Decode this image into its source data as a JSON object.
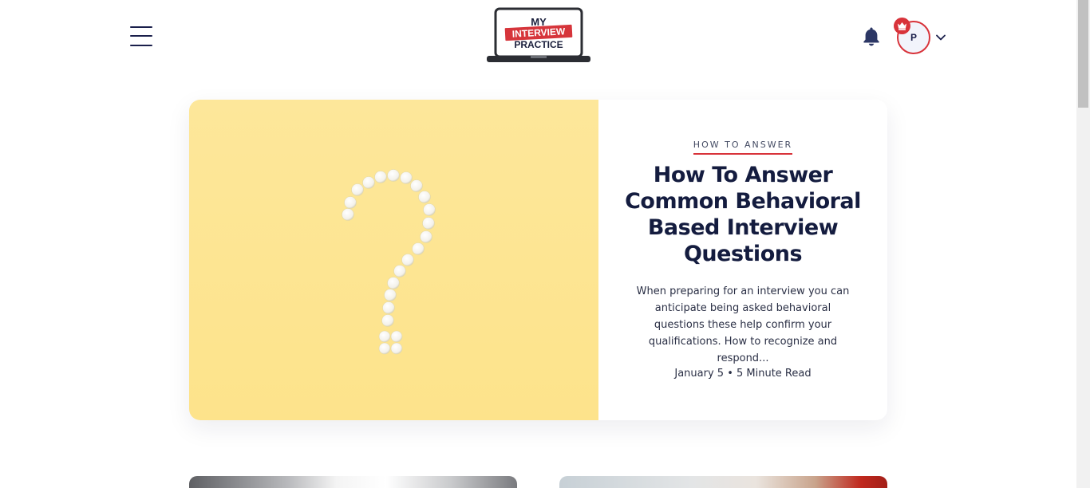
{
  "header": {
    "logo": {
      "line1": "MY",
      "line2": "INTERVIEW",
      "line3": "PRACTICE"
    },
    "menu_icon": "hamburger-menu-icon",
    "notification_icon": "bell-icon",
    "profile": {
      "initial": "P",
      "badge_icon": "crown-icon",
      "dropdown_icon": "chevron-down-icon"
    }
  },
  "featured_post": {
    "category": "HOW TO ANSWER",
    "title": "How To Answer Common Behavioral Based Interview Questions",
    "excerpt": "When preparing for an interview you can anticipate being asked behavioral questions these help confirm your qualifications. How to recognize and respond...",
    "meta": "January 5 • 5 Minute Read",
    "image": "question-mark-pills-on-yellow"
  },
  "colors": {
    "navy": "#141c3f",
    "accent_red": "#d8333a",
    "image_yellow": "#fde38b",
    "card_shadow": "rgba(20,30,60,0.08)"
  }
}
